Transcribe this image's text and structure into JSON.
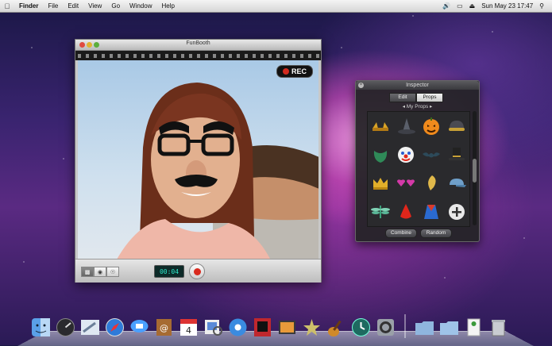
{
  "menubar": {
    "app_name": "Finder",
    "items": [
      "File",
      "Edit",
      "View",
      "Go",
      "Window",
      "Help"
    ],
    "clock": "Sun May 23  17:47"
  },
  "funbooth": {
    "title": "FunBooth",
    "rec_label": "REC",
    "timer": "00:04"
  },
  "inspector": {
    "title": "Inspector",
    "tabs": [
      "Edit",
      "Props"
    ],
    "selected_tab": "Props",
    "section": "My Props",
    "buttons": {
      "combine": "Combine",
      "random": "Random"
    },
    "props": [
      "horn-rims",
      "witch-hat",
      "pumpkin-head",
      "pilot-helmet",
      "green-beard",
      "clown-face",
      "bat-wings",
      "top-hat",
      "gold-crown",
      "heart-glasses",
      "golden-feather",
      "blue-cap",
      "dragonfly",
      "red-nose",
      "super-cape",
      "add-prop"
    ]
  },
  "dock": {
    "apps": [
      "finder-icon",
      "dashboard-icon",
      "mail-icon",
      "safari-icon",
      "ichat-icon",
      "address-book-icon",
      "ical-icon",
      "preview-icon",
      "itunes-icon",
      "photo-booth-icon",
      "iphoto-icon",
      "imovie-icon",
      "garageband-icon",
      "time-machine-icon",
      "system-preferences-icon"
    ],
    "stacks": [
      "applications-folder-icon",
      "documents-folder-icon",
      "downloads-stack-icon",
      "trash-icon"
    ]
  },
  "colors": {
    "rec_red": "#d12a1f",
    "timer_green": "#2eeacc",
    "inspector_bg": "#232326"
  }
}
